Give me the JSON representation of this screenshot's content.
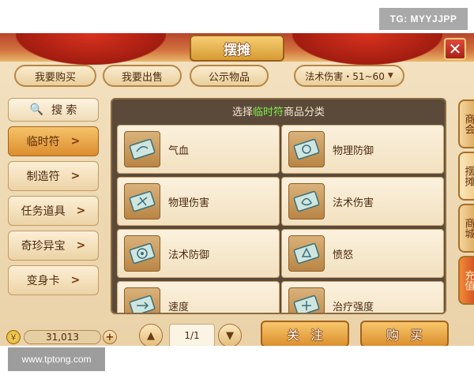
{
  "watermarks": {
    "tg": "TG: MYYJJPP",
    "site": "www.tptong.com"
  },
  "header": {
    "title": "摆摊",
    "close_symbol": "✕"
  },
  "tabs": [
    {
      "label": "我要购买"
    },
    {
      "label": "我要出售"
    },
    {
      "label": "公示物品"
    }
  ],
  "filter": {
    "selected": "法术伤害・51~60",
    "arrow": "▼"
  },
  "search": {
    "icon": "🔍",
    "label": "搜 索"
  },
  "categories": [
    {
      "label": "临时符",
      "active": true
    },
    {
      "label": "制造符"
    },
    {
      "label": "任务道具"
    },
    {
      "label": "奇珍异宝"
    },
    {
      "label": "变身卡"
    }
  ],
  "panel": {
    "title_prefix": "选择",
    "title_highlight": "临时符",
    "title_suffix": "商品分类",
    "items": [
      "气血",
      "物理防御",
      "物理伤害",
      "法术伤害",
      "法术防御",
      "愤怒",
      "速度",
      "治疗强度"
    ]
  },
  "bottom": {
    "coin_symbol": "¥",
    "silver": "31,013",
    "plus": "+",
    "page": "1/1",
    "up": "▲",
    "down": "▼",
    "follow_label": "关注",
    "buy_label": "购买"
  },
  "side_tabs": [
    "商会",
    "摆摊",
    "商城",
    "充值"
  ],
  "colors": {
    "accent": "#dc8f2e",
    "highlight": "#7cf04a",
    "panel_bg": "#5b4a39"
  }
}
